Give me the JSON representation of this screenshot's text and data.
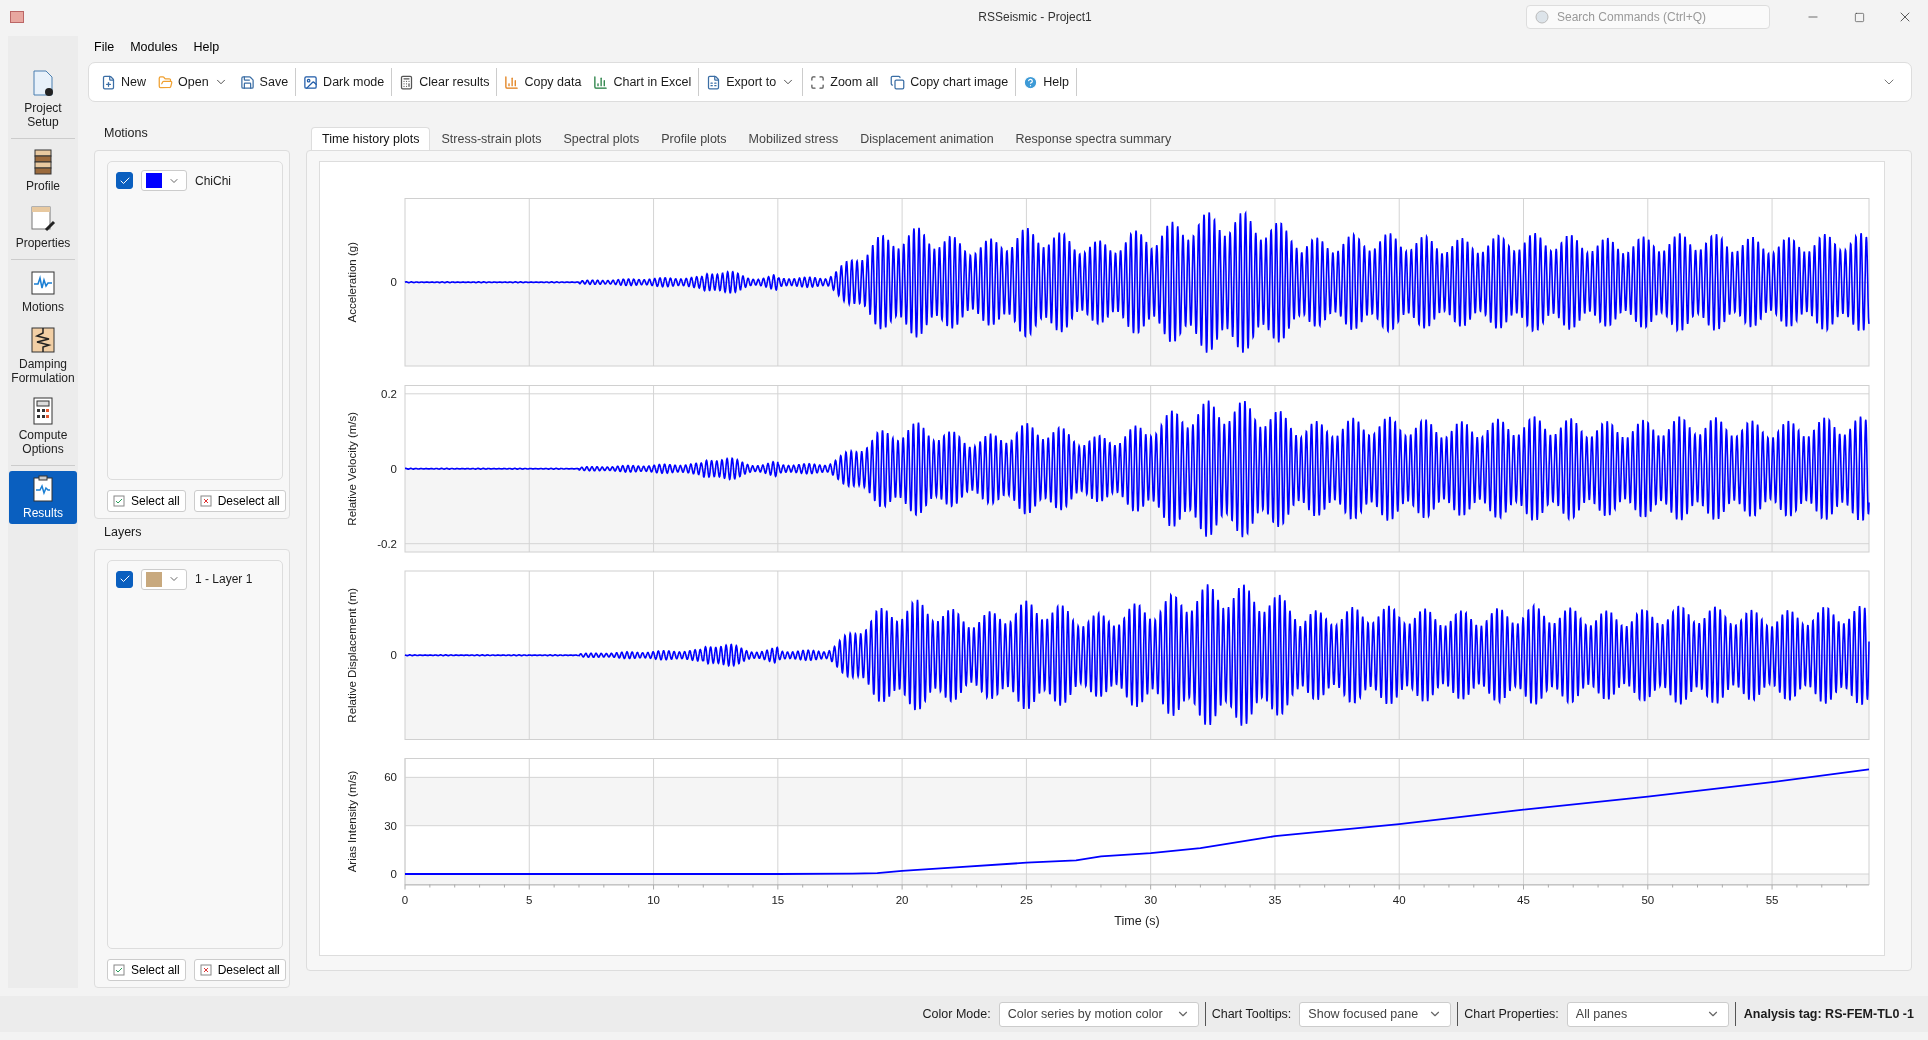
{
  "window": {
    "title": "RSSeismic - Project1"
  },
  "search": {
    "placeholder": "Search Commands (Ctrl+Q)"
  },
  "menu": [
    "File",
    "Modules",
    "Help"
  ],
  "toolbar": [
    {
      "kind": "new",
      "label": "New",
      "dropdown": false,
      "divider_after": false
    },
    {
      "kind": "open",
      "label": "Open",
      "dropdown": true,
      "divider_after": false
    },
    {
      "kind": "save",
      "label": "Save",
      "dropdown": false,
      "divider_after": true
    },
    {
      "kind": "dark",
      "label": "Dark mode",
      "dropdown": false,
      "divider_after": true
    },
    {
      "kind": "clear",
      "label": "Clear results",
      "dropdown": false,
      "divider_after": true
    },
    {
      "kind": "copy",
      "label": "Copy data",
      "dropdown": false,
      "divider_after": false
    },
    {
      "kind": "excel",
      "label": "Chart in Excel",
      "dropdown": false,
      "divider_after": true
    },
    {
      "kind": "export",
      "label": "Export to",
      "dropdown": true,
      "divider_after": true
    },
    {
      "kind": "zoom",
      "label": "Zoom all",
      "dropdown": false,
      "divider_after": false
    },
    {
      "kind": "image",
      "label": "Copy chart image",
      "dropdown": false,
      "divider_after": true
    },
    {
      "kind": "help",
      "label": "Help",
      "dropdown": false,
      "divider_after": true
    }
  ],
  "nav": [
    {
      "kind": "setup",
      "label": "Project Setup",
      "selected": false,
      "divider_before": false
    },
    {
      "kind": "profile",
      "label": "Profile",
      "selected": false,
      "divider_before": true
    },
    {
      "kind": "properties",
      "label": "Properties",
      "selected": false,
      "divider_before": false
    },
    {
      "kind": "motions",
      "label": "Motions",
      "selected": false,
      "divider_before": true
    },
    {
      "kind": "damping",
      "label": "Damping Formulation",
      "selected": false,
      "divider_before": false
    },
    {
      "kind": "compute",
      "label": "Compute Options",
      "selected": false,
      "divider_before": false
    },
    {
      "kind": "results",
      "label": "Results",
      "selected": true,
      "divider_before": true
    }
  ],
  "groups": [
    {
      "title": "Motions",
      "items": [
        {
          "label": "ChiChi",
          "checked": true,
          "color": "#0000ff"
        }
      ],
      "buttons": [
        "Select all",
        "Deselect all"
      ]
    },
    {
      "title": "Layers",
      "items": [
        {
          "label": "1 - Layer 1",
          "checked": true,
          "color": "#c8a97e"
        }
      ],
      "buttons": [
        "Select all",
        "Deselect all"
      ]
    }
  ],
  "tabs": [
    {
      "label": "Time history plots",
      "selected": true
    },
    {
      "label": "Stress-strain plots",
      "selected": false
    },
    {
      "label": "Spectral plots",
      "selected": false
    },
    {
      "label": "Profile plots",
      "selected": false
    },
    {
      "label": "Mobilized stress",
      "selected": false
    },
    {
      "label": "Displacement animation",
      "selected": false
    },
    {
      "label": "Response spectra summary",
      "selected": false
    }
  ],
  "waveform_panes": [
    {
      "kind": "acceleration",
      "ylabel": "Acceleration (g)",
      "yticks": [
        "0"
      ]
    },
    {
      "kind": "velocity",
      "ylabel": "Relative Velocity (m/s)",
      "yticks": [
        "0.2",
        "0",
        "-0.2"
      ]
    },
    {
      "kind": "displacement",
      "ylabel": "Relative Displacement (m)",
      "yticks": [
        "0"
      ]
    }
  ],
  "arias": {
    "chart_data": {
      "type": "line",
      "ylabel": "Arias Intensity (m/s)",
      "xlabel": "Time (s)",
      "x": [
        0,
        5,
        10,
        15,
        18,
        19,
        20,
        22,
        25,
        27,
        28,
        30,
        32,
        34,
        35,
        40,
        45,
        50,
        55,
        58.9
      ],
      "grid": true,
      "series": [
        {
          "color": "#0000ff",
          "values": [
            0,
            0,
            0,
            0,
            0.2,
            0.6,
            2,
            4,
            7,
            8.5,
            11,
            13,
            16,
            21,
            23.5,
            31,
            40,
            48,
            57,
            65
          ]
        }
      ],
      "xlim": [
        0,
        58.9
      ],
      "ylim": [
        -6.5,
        71.7
      ],
      "xticks": [
        0,
        5,
        10,
        15,
        20,
        25,
        30,
        35,
        40,
        45,
        50,
        55
      ],
      "yticks": [
        0,
        30,
        60
      ]
    }
  },
  "status": [
    {
      "label": "Color Mode:",
      "value": "Color series by motion color"
    },
    {
      "label": "Chart Tooltips:",
      "value": "Show focused pane"
    },
    {
      "label": "Chart Properties:",
      "value": "All panes"
    }
  ],
  "analysis_tag": "Analysis tag: RS-FEM-TL0 -1"
}
